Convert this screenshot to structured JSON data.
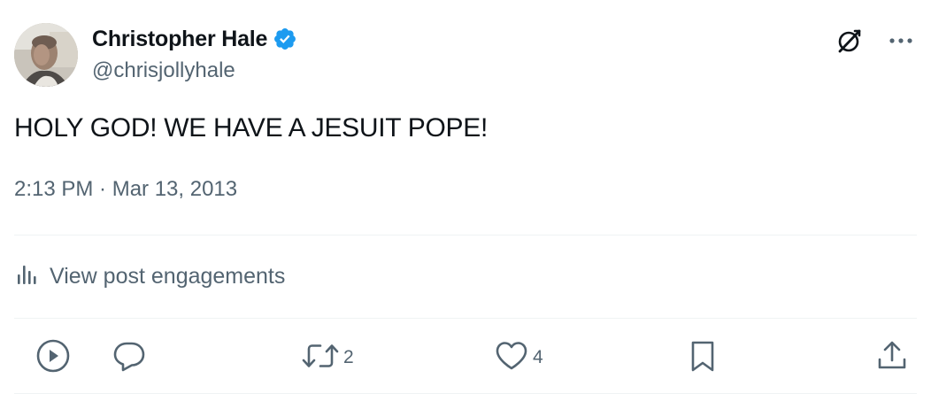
{
  "author": {
    "display_name": "Christopher Hale",
    "handle": "@chrisjollyhale",
    "verified": true,
    "verified_color": "#1d9bf0"
  },
  "header_icons": [
    "grok-icon",
    "more-icon"
  ],
  "post": {
    "text": "HOLY GOD! WE HAVE A JESUIT POPE!",
    "timestamp": "2:13 PM · Mar 13, 2013"
  },
  "engagements": {
    "label": "View post engagements",
    "icon": "analytics-icon"
  },
  "actions": {
    "play": {
      "icon": "play-icon"
    },
    "reply": {
      "icon": "reply-icon",
      "count": ""
    },
    "repost": {
      "icon": "repost-icon",
      "count": "2"
    },
    "like": {
      "icon": "heart-icon",
      "count": "4"
    },
    "bookmark": {
      "icon": "bookmark-icon"
    },
    "share": {
      "icon": "share-icon"
    }
  },
  "colors": {
    "text_primary": "#0f1419",
    "text_secondary": "#536471",
    "divider": "#eff3f4"
  }
}
